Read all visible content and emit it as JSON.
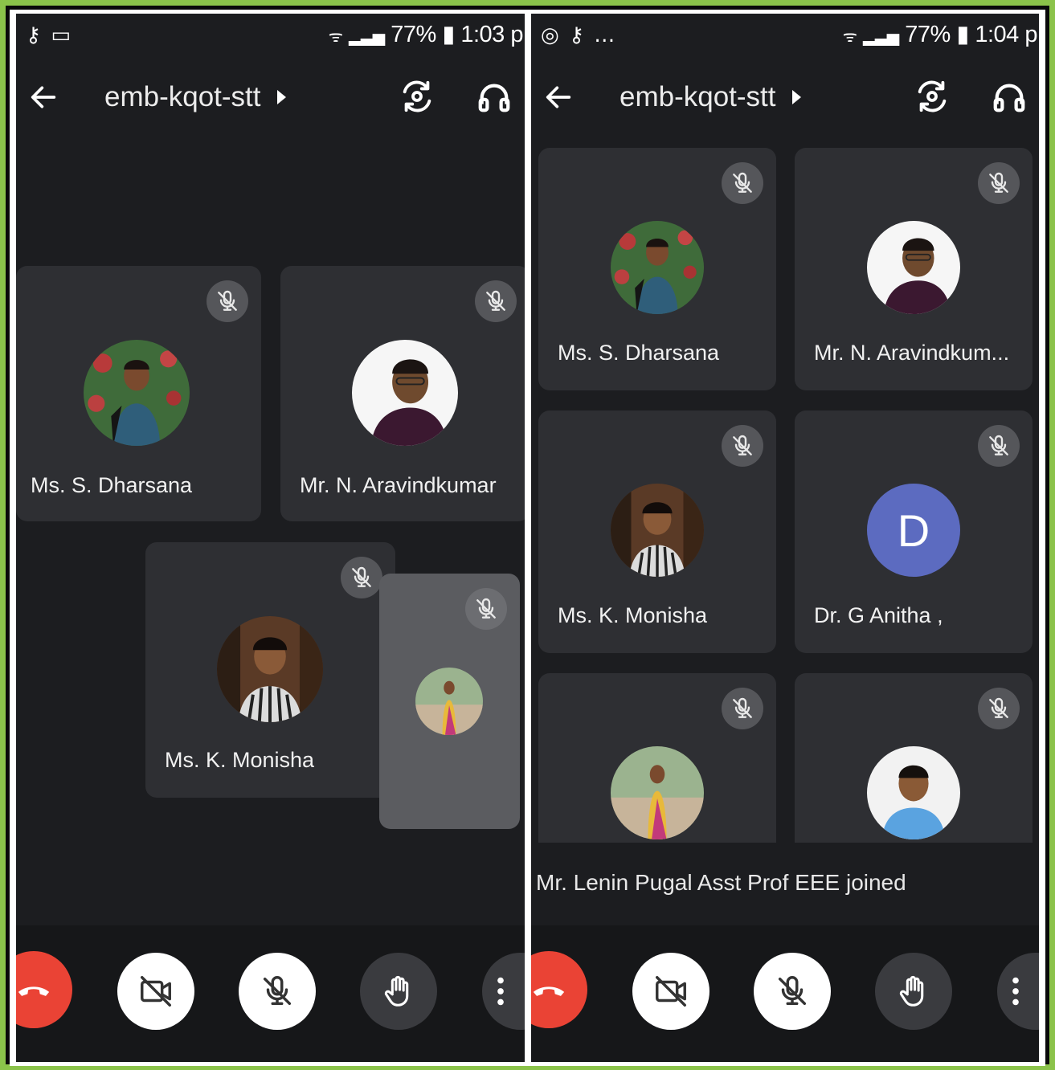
{
  "left_screen": {
    "status_left_icons": [
      "key-icon",
      "video-recording-icon"
    ],
    "status_right": "77% ▮ 1:03 p",
    "meeting_code": "emb-kqot-stt",
    "participants": [
      {
        "name": "Ms. S. Dharsana",
        "muted": true
      },
      {
        "name": "Mr. N. Aravindkumar",
        "muted": true
      },
      {
        "name": "Ms. K. Monisha",
        "muted": true
      }
    ],
    "self_view_muted": true
  },
  "right_screen": {
    "status_left": "…",
    "status_right": "77% ▮ 1:04 p",
    "meeting_code": "emb-kqot-stt",
    "participants": [
      {
        "name": "Ms. S. Dharsana",
        "muted": true
      },
      {
        "name": "Mr. N. Aravindkum...",
        "muted": true
      },
      {
        "name": "Ms. K. Monisha",
        "muted": true
      },
      {
        "name": "Dr. G Anitha ,",
        "muted": true,
        "initial": "D"
      },
      {
        "name": "",
        "muted": true
      },
      {
        "name": "",
        "muted": true
      }
    ],
    "toast": "Mr. Lenin Pugal Asst Prof EEE joined"
  },
  "colors": {
    "frame_border": "#8bc34a",
    "background": "#1c1d20",
    "tile": "#2e2f33",
    "end_call": "#ea4335",
    "initial_avatar": "#5c6bc0"
  }
}
